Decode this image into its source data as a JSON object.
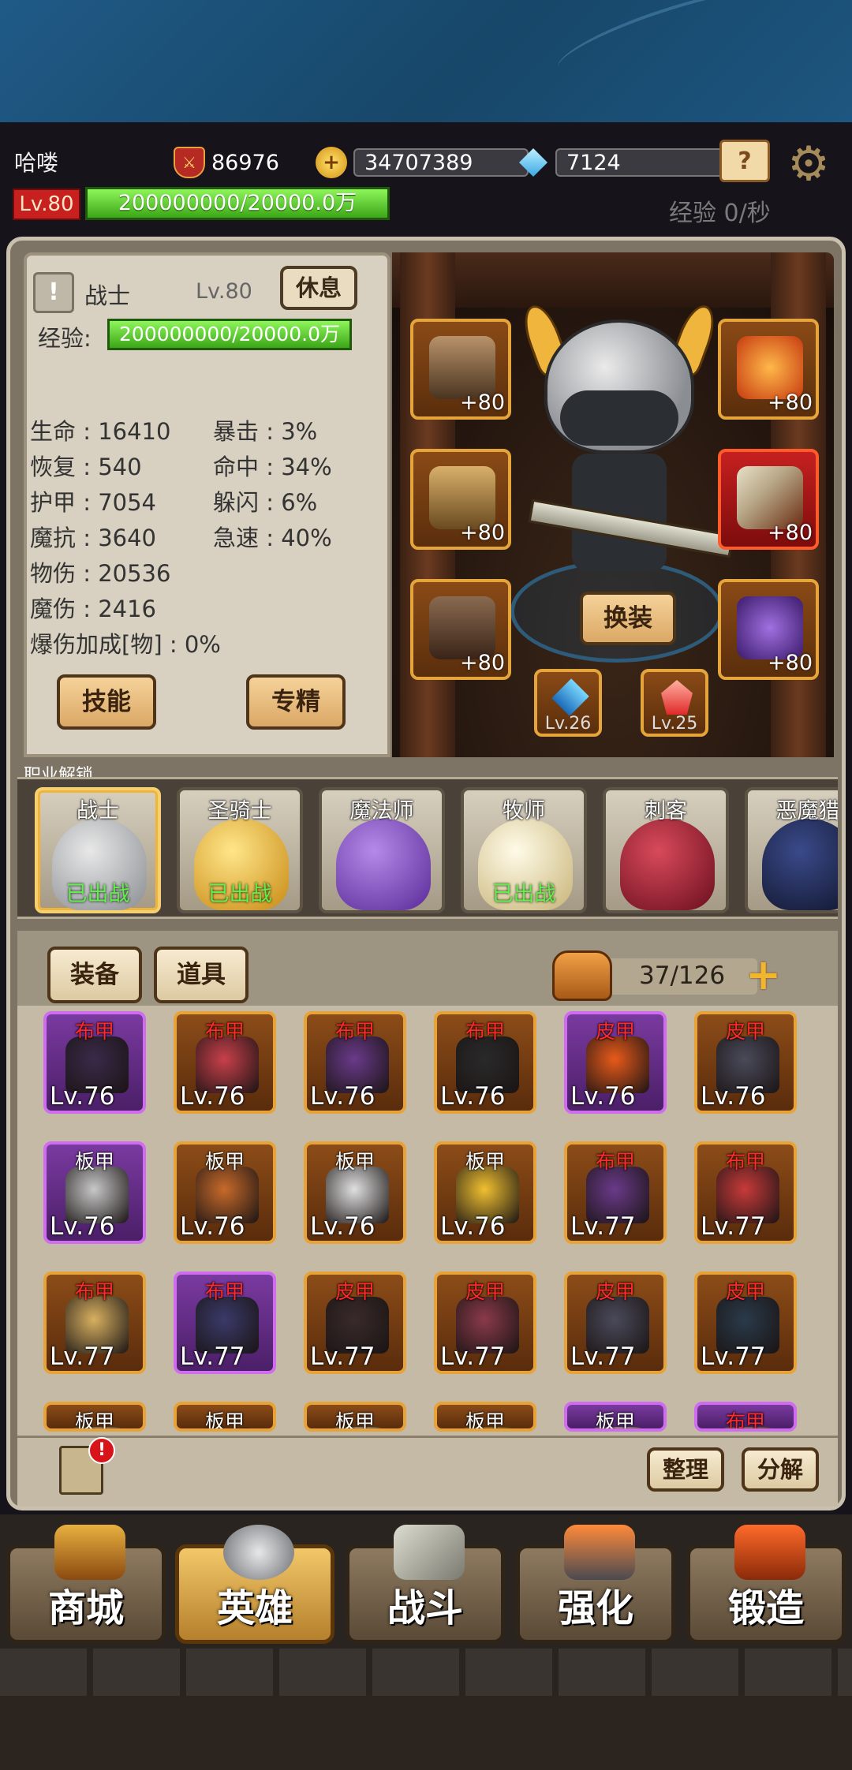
{
  "header": {
    "player_name": "哈喽",
    "power": "86976",
    "gold": "34707389",
    "gems": "7124",
    "level_badge": "Lv.80",
    "exp_text": "200000000/20000.0万",
    "exp_rate": "经验 0/秒"
  },
  "hero_panel": {
    "class_name": "战士",
    "class_level": "Lv.80",
    "rest_label": "休息",
    "exp_label": "经验:",
    "exp_text": "200000000/20000.0万",
    "stats_left": [
      "生命 : 16410",
      "恢复 : 540",
      "护甲 : 7054",
      "魔抗 : 3640",
      "物伤 : 20536",
      "魔伤 : 2416",
      "爆伤加成[物] : 0%"
    ],
    "stats_right": [
      "暴击 : 3%",
      "命中 : 34%",
      "躲闪 : 6%",
      "急速 : 40%"
    ],
    "skill_label": "技能",
    "specialize_label": "专精",
    "change_label": "换装",
    "equip_plus": [
      "+80",
      "+80",
      "+80",
      "+80",
      "+80",
      "+80"
    ],
    "gem_levels": [
      "Lv.26",
      "Lv.25"
    ]
  },
  "class_section": {
    "title": "职业解锁",
    "classes": [
      {
        "name": "战士",
        "status": "已出战"
      },
      {
        "name": "圣骑士",
        "status": "已出战"
      },
      {
        "name": "魔法师",
        "status": ""
      },
      {
        "name": "牧师",
        "status": "已出战"
      },
      {
        "name": "刺客",
        "status": ""
      },
      {
        "name": "恶魔猎",
        "status": ""
      }
    ]
  },
  "bag": {
    "tab_equip": "装备",
    "tab_items": "道具",
    "capacity": "37/126",
    "items": [
      {
        "type": "布甲",
        "lvl": "Lv.76"
      },
      {
        "type": "布甲",
        "lvl": "Lv.76"
      },
      {
        "type": "布甲",
        "lvl": "Lv.76"
      },
      {
        "type": "布甲",
        "lvl": "Lv.76"
      },
      {
        "type": "皮甲",
        "lvl": "Lv.76"
      },
      {
        "type": "皮甲",
        "lvl": "Lv.76"
      },
      {
        "type": "板甲",
        "lvl": "Lv.76"
      },
      {
        "type": "板甲",
        "lvl": "Lv.76"
      },
      {
        "type": "板甲",
        "lvl": "Lv.76"
      },
      {
        "type": "板甲",
        "lvl": "Lv.76"
      },
      {
        "type": "布甲",
        "lvl": "Lv.77"
      },
      {
        "type": "布甲",
        "lvl": "Lv.77"
      },
      {
        "type": "布甲",
        "lvl": "Lv.77"
      },
      {
        "type": "布甲",
        "lvl": "Lv.77"
      },
      {
        "type": "皮甲",
        "lvl": "Lv.77"
      },
      {
        "type": "皮甲",
        "lvl": "Lv.77"
      },
      {
        "type": "皮甲",
        "lvl": "Lv.77"
      },
      {
        "type": "皮甲",
        "lvl": "Lv.77"
      },
      {
        "type": "板甲",
        "lvl": ""
      },
      {
        "type": "板甲",
        "lvl": ""
      },
      {
        "type": "板甲",
        "lvl": ""
      },
      {
        "type": "板甲",
        "lvl": ""
      },
      {
        "type": "板甲",
        "lvl": ""
      },
      {
        "type": "布甲",
        "lvl": ""
      }
    ],
    "notice_badge": "!",
    "sort_label": "整理",
    "decompose_label": "分解"
  },
  "nav": {
    "items": [
      "商城",
      "英雄",
      "战斗",
      "强化",
      "锻造"
    ]
  }
}
